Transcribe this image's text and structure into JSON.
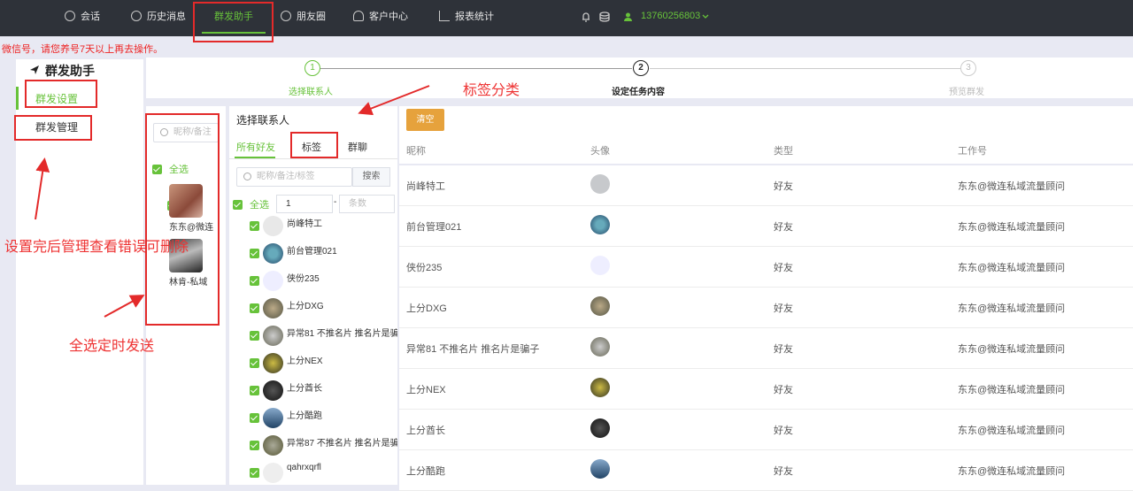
{
  "nav": {
    "items": [
      {
        "label": "会话",
        "icon": "chat-icon"
      },
      {
        "label": "历史消息",
        "icon": "clock-icon"
      },
      {
        "label": "群发助手",
        "icon": "none",
        "active": true
      },
      {
        "label": "朋友圈",
        "icon": "moments-icon"
      },
      {
        "label": "客户中心",
        "icon": "user-icon"
      },
      {
        "label": "报表统计",
        "icon": "bar-chart-icon"
      }
    ],
    "phone": "13760256803"
  },
  "warning": "微信号，请您养号7天以上再去操作。",
  "sidebar": {
    "title": "群发助手",
    "items": [
      "群发设置",
      "群发管理"
    ]
  },
  "steps": [
    {
      "num": "1",
      "label": "选择联系人",
      "state": "done"
    },
    {
      "num": "2",
      "label": "设定任务内容",
      "state": "current"
    },
    {
      "num": "3",
      "label": "预览群发",
      "state": "todo"
    }
  ],
  "account_panel": {
    "search_placeholder": "昵称/备注",
    "select_all": "全选",
    "accounts": [
      "东东@微连",
      "林肯-私域"
    ]
  },
  "contact_panel": {
    "title": "选择联系人",
    "tabs": [
      "所有好友",
      "标签",
      "群聊"
    ],
    "search_placeholder": "昵称/备注/标签",
    "search_button": "搜索",
    "select_all": "全选",
    "range_from": "1",
    "range_sep": "-",
    "range_placeholder": "条数",
    "contacts": [
      "尚峰特工",
      "前台管理021",
      "侠份235",
      "上分DXG",
      "异常81 不推名片 推名片是骗子",
      "上分NEX",
      "上分酋长",
      "上分酷跑",
      "异常87 不推名片 推名片是骗子",
      "qahrxqrfl"
    ]
  },
  "table": {
    "clear_button": "清空",
    "headers": [
      "昵称",
      "头像",
      "类型",
      "工作号"
    ],
    "rows": [
      {
        "name": "尚峰特工",
        "type": "好友",
        "work": "东东@微连私域流量顾问"
      },
      {
        "name": "前台管理021",
        "type": "好友",
        "work": "东东@微连私域流量顾问"
      },
      {
        "name": "侠份235",
        "type": "好友",
        "work": "东东@微连私域流量顾问"
      },
      {
        "name": "上分DXG",
        "type": "好友",
        "work": "东东@微连私域流量顾问"
      },
      {
        "name": "异常81 不推名片 推名片是骗子",
        "type": "好友",
        "work": "东东@微连私域流量顾问"
      },
      {
        "name": "上分NEX",
        "type": "好友",
        "work": "东东@微连私域流量顾问"
      },
      {
        "name": "上分酋长",
        "type": "好友",
        "work": "东东@微连私域流量顾问"
      },
      {
        "name": "上分酷跑",
        "type": "好友",
        "work": "东东@微连私域流量顾问"
      }
    ]
  },
  "annotations": {
    "tag_category": "标签分类",
    "manage_note": "设置完后管理查看错误可删除",
    "select_all_note": "全选定时发送"
  },
  "colors": {
    "accent": "#67c23a",
    "annotation": "#e32a2a",
    "clear_button": "#e6a23c",
    "topbar": "#2e3239"
  }
}
